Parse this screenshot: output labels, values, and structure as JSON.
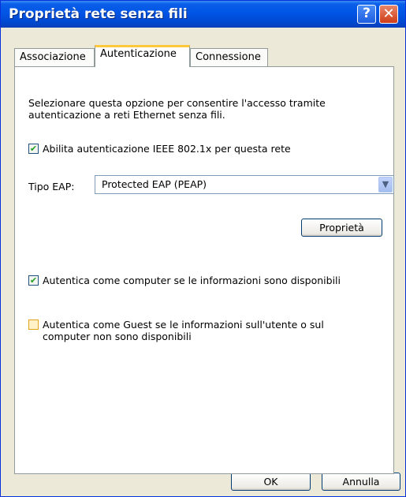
{
  "window": {
    "title": "Proprietà rete senza fili",
    "help_glyph": "?",
    "close_glyph": "✕"
  },
  "tabs": [
    {
      "label": "Associazione",
      "selected": false
    },
    {
      "label": "Autenticazione",
      "selected": true
    },
    {
      "label": "Connessione",
      "selected": false
    }
  ],
  "panel": {
    "description_line1": "Selezionare questa opzione per consentire l'accesso tramite",
    "description_line2": "autenticazione a reti Ethernet senza fili.",
    "enable_8021x": {
      "label": "Abilita autenticazione IEEE 802.1x per questa rete",
      "checked": true
    },
    "eap": {
      "label": "Tipo EAP:",
      "value": "Protected EAP (PEAP)"
    },
    "properties_button": "Proprietà",
    "auth_computer": {
      "label": "Autentica come computer se le informazioni sono disponibili",
      "checked": true
    },
    "auth_guest": {
      "line1": "Autentica come Guest se le informazioni sull'utente o sul",
      "line2": "computer non sono disponibili",
      "checked": false
    }
  },
  "footer": {
    "ok": "OK",
    "cancel": "Annulla"
  },
  "icons": {
    "check": "✔",
    "dropdown": "▼"
  },
  "colors": {
    "titlebar": "#0055e5",
    "dialog_bg": "#ece9d8",
    "tab_highlight": "#ffc83c",
    "checkmark": "#21a121"
  }
}
